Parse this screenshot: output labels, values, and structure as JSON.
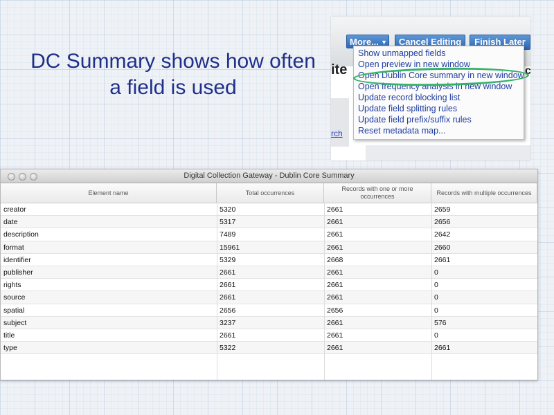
{
  "slide": {
    "title": "DC Summary shows how often a field is used"
  },
  "inset": {
    "buttons": {
      "more": "More...",
      "cancel": "Cancel Editing",
      "finish": "Finish Later"
    },
    "background_text": "ite",
    "background_text_right": "c",
    "link": "rch",
    "menu": [
      "Show unmapped fields",
      "Open preview in new window",
      "Open Dublin Core summary in new window",
      "Open frequency analysis in new window",
      "Update record blocking list",
      "Update field splitting rules",
      "Update field prefix/suffix rules",
      "Reset metadata map..."
    ],
    "highlight_color": "#35b26a"
  },
  "window": {
    "title": "Digital Collection Gateway - Dublin Core Summary",
    "columns": [
      "Element name",
      "Total occurrences",
      "Records with one or more occurrences",
      "Records with multiple occurrences"
    ],
    "rows": [
      [
        "creator",
        "5320",
        "2661",
        "2659"
      ],
      [
        "date",
        "5317",
        "2661",
        "2656"
      ],
      [
        "description",
        "7489",
        "2661",
        "2642"
      ],
      [
        "format",
        "15961",
        "2661",
        "2660"
      ],
      [
        "identifier",
        "5329",
        "2668",
        "2661"
      ],
      [
        "publisher",
        "2661",
        "2661",
        "0"
      ],
      [
        "rights",
        "2661",
        "2661",
        "0"
      ],
      [
        "source",
        "2661",
        "2661",
        "0"
      ],
      [
        "spatial",
        "2656",
        "2656",
        "0"
      ],
      [
        "subject",
        "3237",
        "2661",
        "576"
      ],
      [
        "title",
        "2661",
        "2661",
        "0"
      ],
      [
        "type",
        "5322",
        "2661",
        "2661"
      ]
    ]
  },
  "colors": {
    "title_text": "#1f2f8a",
    "button_blue": "#2f68b4",
    "menu_text": "#1f3ea1"
  }
}
